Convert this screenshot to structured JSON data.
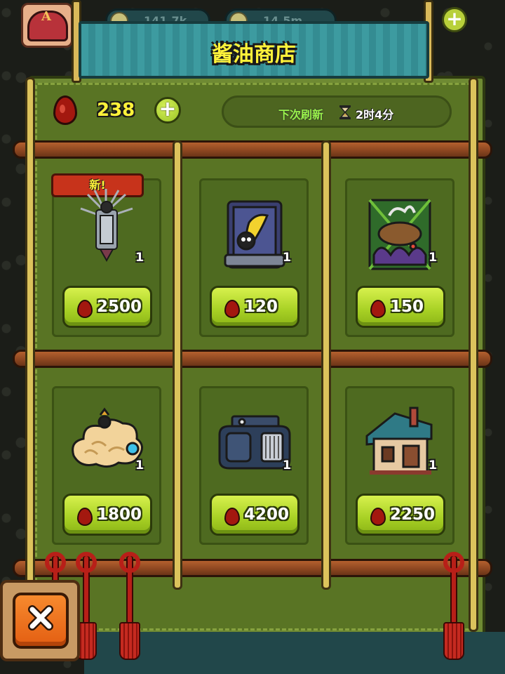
{
  "hud": {
    "coins_label": "141.7k",
    "gems_label": "14.5m",
    "avatar_letter": "A"
  },
  "shop": {
    "title": "酱油商店",
    "currency_value": "238",
    "refresh_label": "下次刷新",
    "refresh_time": "2时4分"
  },
  "items": [
    {
      "name": "mech-glove-art",
      "qty": "1",
      "price": "2500",
      "is_new": true,
      "new_label": "新!"
    },
    {
      "name": "banana-card-art",
      "qty": "1",
      "price": "120",
      "is_new": false
    },
    {
      "name": "octopus-cauldron-art",
      "qty": "1",
      "price": "150",
      "is_new": false
    },
    {
      "name": "cloud-mount-art",
      "qty": "1",
      "price": "1800",
      "is_new": false
    },
    {
      "name": "armored-vehicle-art",
      "qty": "1",
      "price": "4200",
      "is_new": false
    },
    {
      "name": "cottage-art",
      "qty": "1",
      "price": "2250",
      "is_new": false
    }
  ],
  "colors": {
    "accent": "#fff23a",
    "button": "#a7d024",
    "currency_drop": "#a3180f",
    "close": "#e35e12"
  }
}
